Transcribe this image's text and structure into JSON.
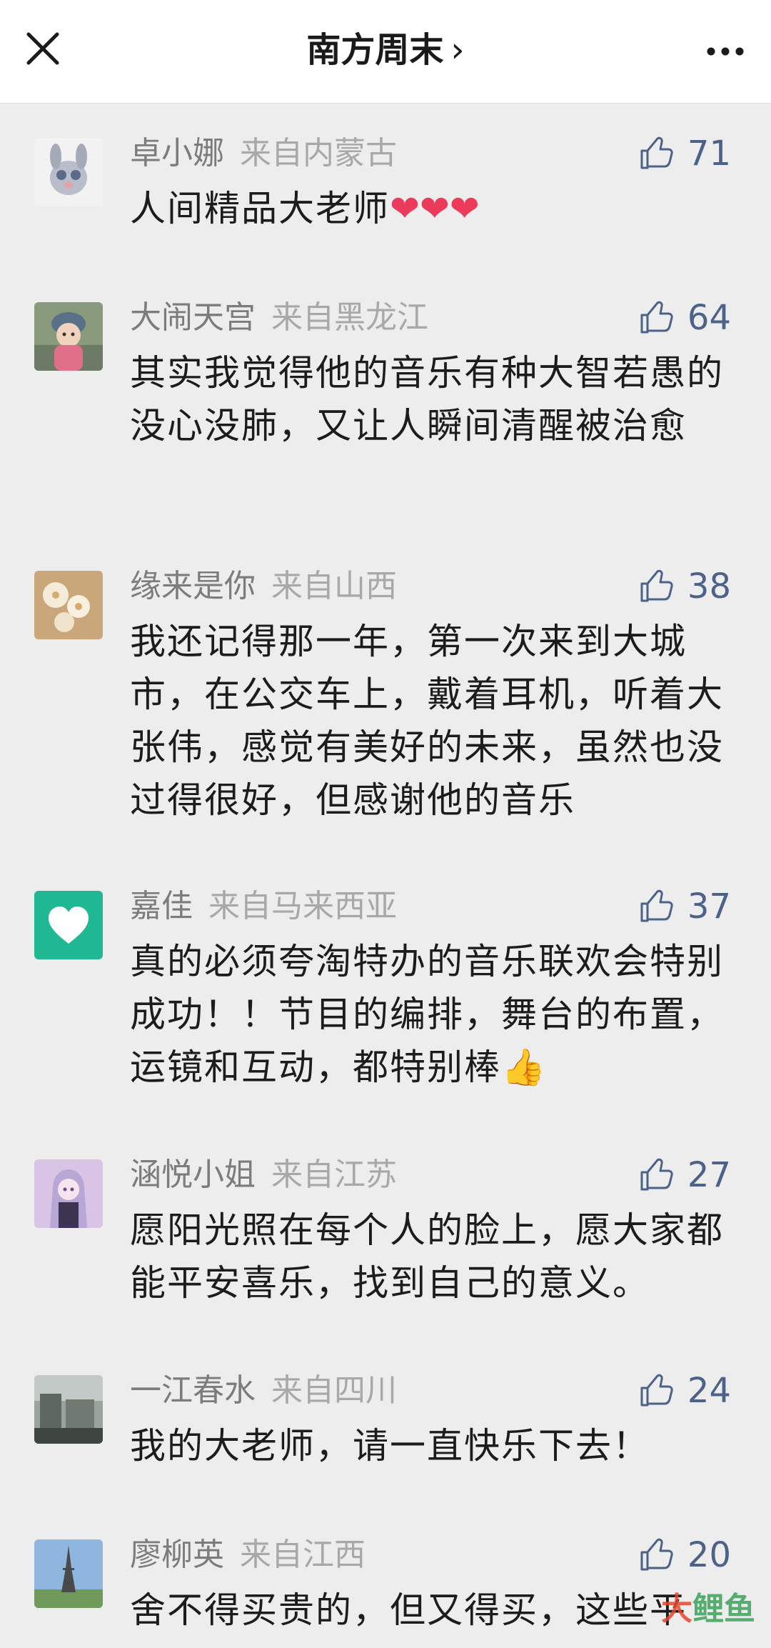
{
  "nav": {
    "title": "南方周末",
    "chevron": "›",
    "close_icon": "close-icon",
    "more_icon": "more-icon"
  },
  "colors": {
    "like_count": "#4c6288",
    "name": "#7c7c7c",
    "location": "#a8a8a8",
    "background": "#ededed"
  },
  "comments": [
    {
      "name": "卓小娜",
      "location": "来自内蒙古",
      "likes": "71",
      "text": "人间精品大老师",
      "emoji": "❤❤❤"
    },
    {
      "name": "大闹天宫",
      "location": "来自黑龙江",
      "likes": "64",
      "text": "其实我觉得他的音乐有种大智若愚的没心没肺，又让人瞬间清醒被治愈",
      "emoji": ""
    },
    {
      "name": "缘来是你",
      "location": "来自山西",
      "likes": "38",
      "text": "我还记得那一年，第一次来到大城市，在公交车上，戴着耳机，听着大张伟，感觉有美好的未来，虽然也没过得很好，但感谢他的音乐",
      "emoji": ""
    },
    {
      "name": "嘉佳",
      "location": "来自马来西亚",
      "likes": "37",
      "text": "真的必须夸淘特办的音乐联欢会特别成功！！节目的编排，舞台的布置，运镜和互动，都特别棒",
      "emoji": "👍"
    },
    {
      "name": "涵悦小姐",
      "location": "来自江苏",
      "likes": "27",
      "text": "愿阳光照在每个人的脸上，愿大家都能平安喜乐，找到自己的意义。",
      "emoji": ""
    },
    {
      "name": "一江春水",
      "location": "来自四川",
      "likes": "24",
      "text": "我的大老师，请一直快乐下去！",
      "emoji": ""
    },
    {
      "name": "廖柳英",
      "location": "来自江西",
      "likes": "20",
      "text": "舍不得买贵的，但又得买，这些平",
      "emoji": ""
    }
  ],
  "watermark": {
    "part1": "大",
    "part2": "鲤鱼"
  }
}
